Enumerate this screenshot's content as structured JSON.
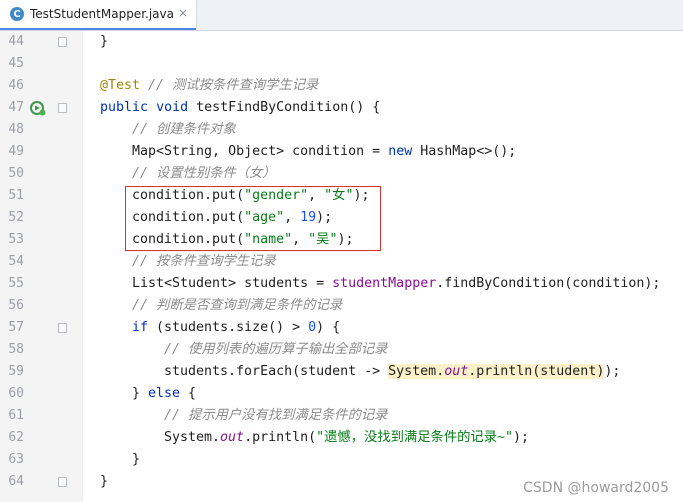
{
  "tab": {
    "title": "TestStudentMapper.java",
    "icon_letter": "C",
    "close": "×"
  },
  "watermark": "CSDN @howard2005",
  "colors": {
    "keyword": "#0033b3",
    "string": "#067d17",
    "number": "#1750eb",
    "comment": "#8c8c8c",
    "annotation": "#9e880d",
    "field": "#871094",
    "highlight_box": "#d9342b"
  },
  "lines": [
    {
      "num": "44",
      "t": [
        "}"
      ]
    },
    {
      "num": "45",
      "t": []
    },
    {
      "num": "46",
      "t": [
        "@Test",
        " ",
        "// 测试按条件查询学生记录"
      ]
    },
    {
      "num": "47",
      "t": [
        "public",
        " ",
        "void",
        " testFindByCondition() {"
      ]
    },
    {
      "num": "48",
      "t": [
        "// 创建条件对象"
      ]
    },
    {
      "num": "49",
      "t": [
        "Map<String, Object> condition = ",
        "new",
        " HashMap<>();"
      ]
    },
    {
      "num": "50",
      "t": [
        "// 设置性别条件（女）"
      ]
    },
    {
      "num": "51",
      "t": [
        "condition.put(",
        "\"gender\"",
        ", ",
        "\"女\"",
        ");"
      ]
    },
    {
      "num": "52",
      "t": [
        "condition.put(",
        "\"age\"",
        ", ",
        "19",
        ");"
      ]
    },
    {
      "num": "53",
      "t": [
        "condition.put(",
        "\"name\"",
        ", ",
        "\"吴\"",
        ");"
      ]
    },
    {
      "num": "54",
      "t": [
        "// 按条件查询学生记录"
      ]
    },
    {
      "num": "55",
      "t": [
        "List<Student> students = ",
        "studentMapper",
        ".findByCondition(condition);"
      ]
    },
    {
      "num": "56",
      "t": [
        "// 判断是否查询到满足条件的记录"
      ]
    },
    {
      "num": "57",
      "t": [
        "if",
        " (students.size() > ",
        "0",
        ") {"
      ]
    },
    {
      "num": "58",
      "t": [
        "// 使用列表的遍历算子输出全部记录"
      ]
    },
    {
      "num": "59",
      "t": [
        "students.forEach(student -> ",
        "System.",
        "out",
        ".println(student)",
        ");"
      ]
    },
    {
      "num": "60",
      "t": [
        "} ",
        "else",
        " {"
      ]
    },
    {
      "num": "61",
      "t": [
        "// 提示用户没有找到满足条件的记录"
      ]
    },
    {
      "num": "62",
      "t": [
        "System.",
        "out",
        ".println(",
        "\"遗憾，没找到满足条件的记录~\"",
        ");"
      ]
    },
    {
      "num": "63",
      "t": [
        "}"
      ]
    },
    {
      "num": "64",
      "t": [
        "}"
      ]
    }
  ]
}
